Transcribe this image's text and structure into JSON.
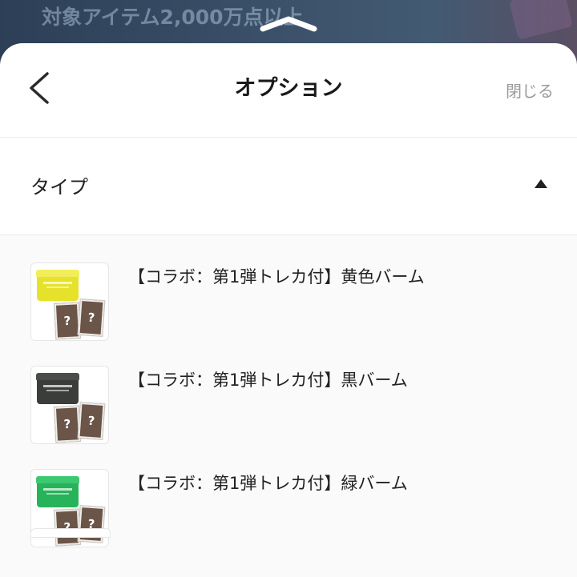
{
  "backdrop": {
    "banner_text": "対象アイテム2,000万点以上"
  },
  "sheet": {
    "title": "オプション",
    "close_label": "閉じる",
    "back_icon": "chevron-left-icon",
    "handle_icon": "chevron-up-icon"
  },
  "type_section": {
    "label": "タイプ",
    "toggle_icon": "caret-up-icon",
    "expanded": true
  },
  "options": [
    {
      "label": "【コラボ：第1弾トレカ付】黄色バーム",
      "jar_color": "#e6e22b",
      "lid_color": "#f2ee5a"
    },
    {
      "label": "【コラボ：第1弾トレカ付】黒バーム",
      "jar_color": "#3a3d3a",
      "lid_color": "#4a4d4a"
    },
    {
      "label": "【コラボ：第1弾トレカ付】緑バーム",
      "jar_color": "#27b35a",
      "lid_color": "#3cc870"
    }
  ],
  "card_glyph": "?",
  "colors": {
    "title_text": "#1a1a1a",
    "close_text": "#9a9a9a",
    "list_background": "#fafafa"
  }
}
